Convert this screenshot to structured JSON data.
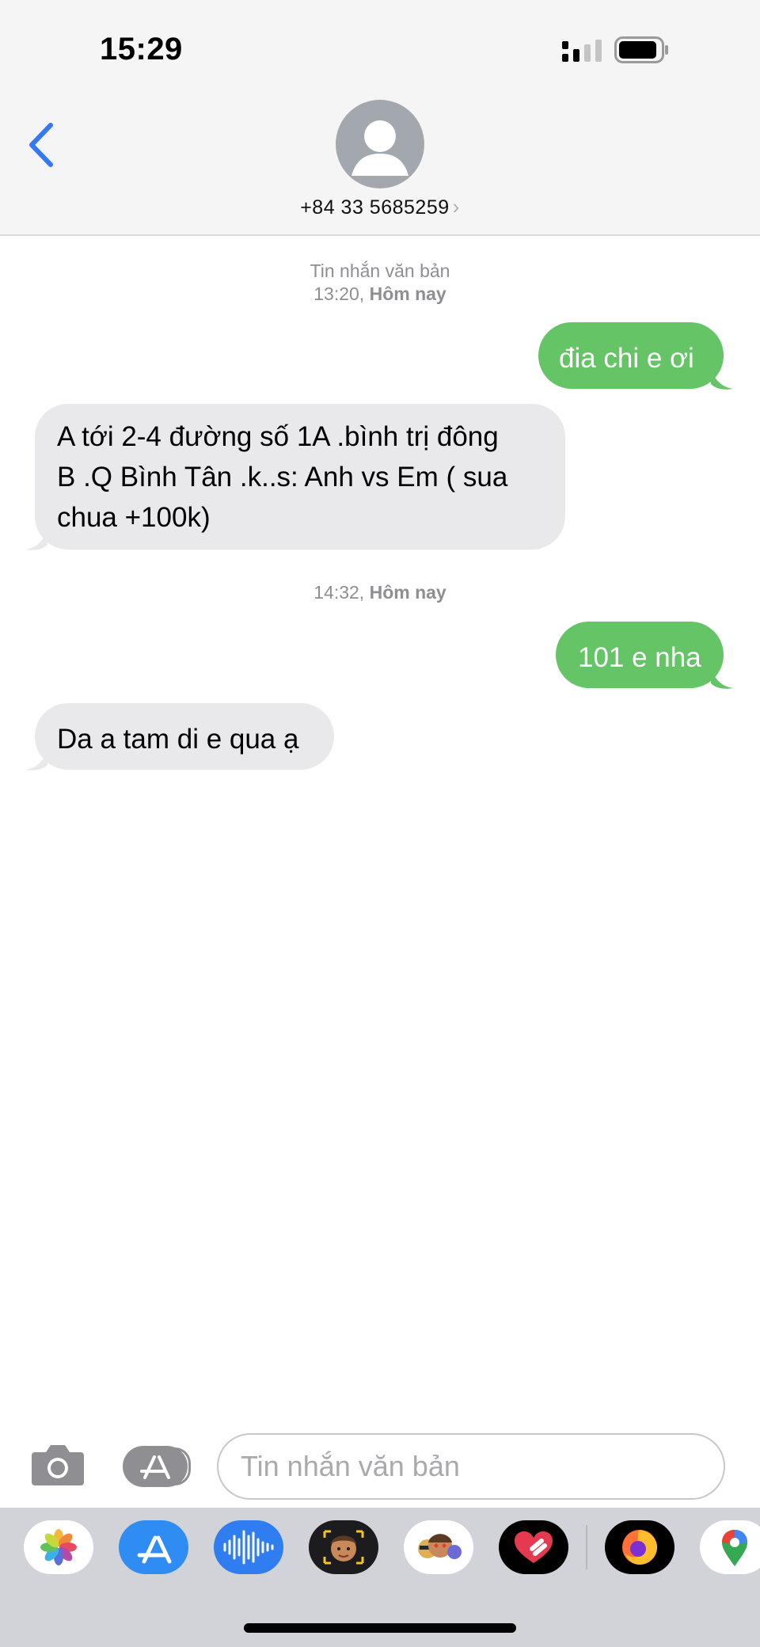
{
  "status_bar": {
    "time": "15:29"
  },
  "header": {
    "contact": "+84 33 5685259",
    "chevron": "›"
  },
  "thread": {
    "timestamp_1": {
      "line1": "Tin nhắn văn bản",
      "time": "13:20,",
      "day": "Hôm nay"
    },
    "msg_1": "đia chi e ơi",
    "msg_2_lines": [
      "A tới 2-4 đường số 1A .bình trị đông",
      "B .Q Bình Tân .k..s: Anh vs Em ( sua",
      "chua +100k)"
    ],
    "timestamp_2": {
      "time": "14:32,",
      "day": "Hôm nay"
    },
    "msg_3": "101 e nha",
    "msg_4": "Da a tam di e qua ạ"
  },
  "compose": {
    "placeholder": "Tin nhắn văn bản"
  },
  "drawer": {
    "apps": [
      "photos-app-icon",
      "app-store-app-icon",
      "audio-message-app-icon",
      "memoji-app-icon",
      "memoji-stickers-app-icon",
      "digital-touch-app-icon",
      "firefox-app-icon",
      "google-maps-app-icon"
    ]
  },
  "colors": {
    "sent_bubble": "#65c466",
    "received_bubble": "#e9e9eb",
    "accent": "#3478f6"
  }
}
